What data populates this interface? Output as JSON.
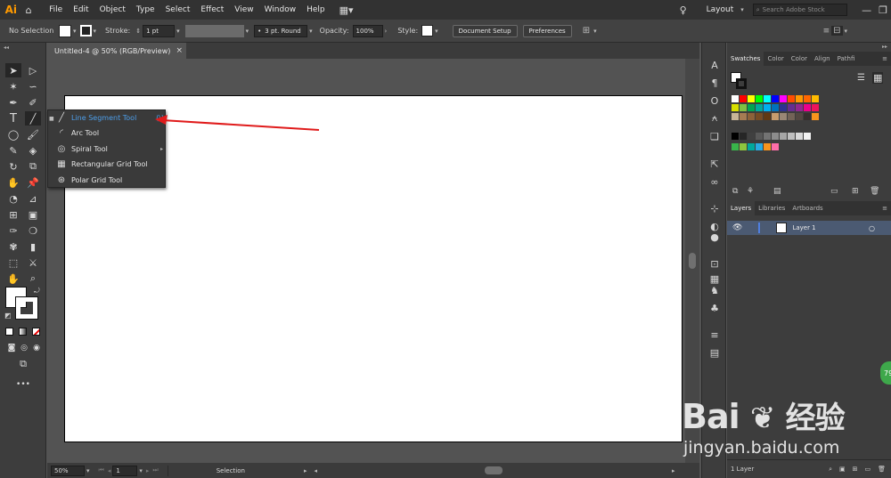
{
  "menu": {
    "logo": "Ai",
    "items": [
      "File",
      "Edit",
      "Object",
      "Type",
      "Select",
      "Effect",
      "View",
      "Window",
      "Help"
    ],
    "workspace": "Layout",
    "search_placeholder": "Search Adobe Stock"
  },
  "control": {
    "selection": "No Selection",
    "stroke_label": "Stroke:",
    "stroke_value": "1 pt",
    "brush": "3 pt. Round",
    "opacity_label": "Opacity:",
    "opacity_value": "100%",
    "style_label": "Style:",
    "doc_setup": "Document Setup",
    "preferences": "Preferences"
  },
  "document": {
    "tab_title": "Untitled-4 @ 50% (RGB/Preview)",
    "close": "×"
  },
  "flyout": {
    "items": [
      {
        "label": "Line Segment Tool",
        "shortcut": "(\\)",
        "icon": "line-icon"
      },
      {
        "label": "Arc Tool",
        "icon": "arc-icon"
      },
      {
        "label": "Spiral Tool",
        "icon": "spiral-icon"
      },
      {
        "label": "Rectangular Grid Tool",
        "icon": "rect-grid-icon"
      },
      {
        "label": "Polar Grid Tool",
        "icon": "polar-grid-icon"
      }
    ]
  },
  "status": {
    "zoom": "50%",
    "artboard": "1",
    "mode": "Selection"
  },
  "swatches_panel": {
    "tabs": [
      "Swatches",
      "Color",
      "Color",
      "Align",
      "Pathfi"
    ],
    "row1": [
      "#ffffff",
      "#ff0000",
      "#ffff00",
      "#00ff00",
      "#00ffff",
      "#0000ff",
      "#ff00ff",
      "#ff4d00",
      "#ff9900",
      "#ff6600",
      "#ffbb00"
    ],
    "row2": [
      "#d8e000",
      "#7dc142",
      "#00a651",
      "#00a99d",
      "#00aeef",
      "#0072bc",
      "#2e3192",
      "#662d91",
      "#92278f",
      "#ec008c",
      "#ed145b"
    ],
    "row3": [
      "#c8b597",
      "#a67c52",
      "#8c6239",
      "#754c24",
      "#603913",
      "#c69c6d",
      "#998675",
      "#736357",
      "#534741",
      "#362f2d",
      "#f7941d"
    ],
    "row4": [
      "#000000",
      "#262626",
      "#404040",
      "#595959",
      "#737373",
      "#8c8c8c",
      "#a6a6a6",
      "#bfbfbf",
      "#d9d9d9",
      "#f2f2f2"
    ],
    "row5": [
      "#39b54a",
      "#8dc63f",
      "#00a99d",
      "#29abe2",
      "#f7941d",
      "#ff6ea8"
    ]
  },
  "layers_panel": {
    "tabs": [
      "Layers",
      "Libraries",
      "Artboards"
    ],
    "layer_name": "Layer 1",
    "footer": "1 Layer"
  },
  "watermark": {
    "brand": "Bai",
    "brand2": "经验",
    "url": "jingyan.baidu.com",
    "badge": "79"
  }
}
